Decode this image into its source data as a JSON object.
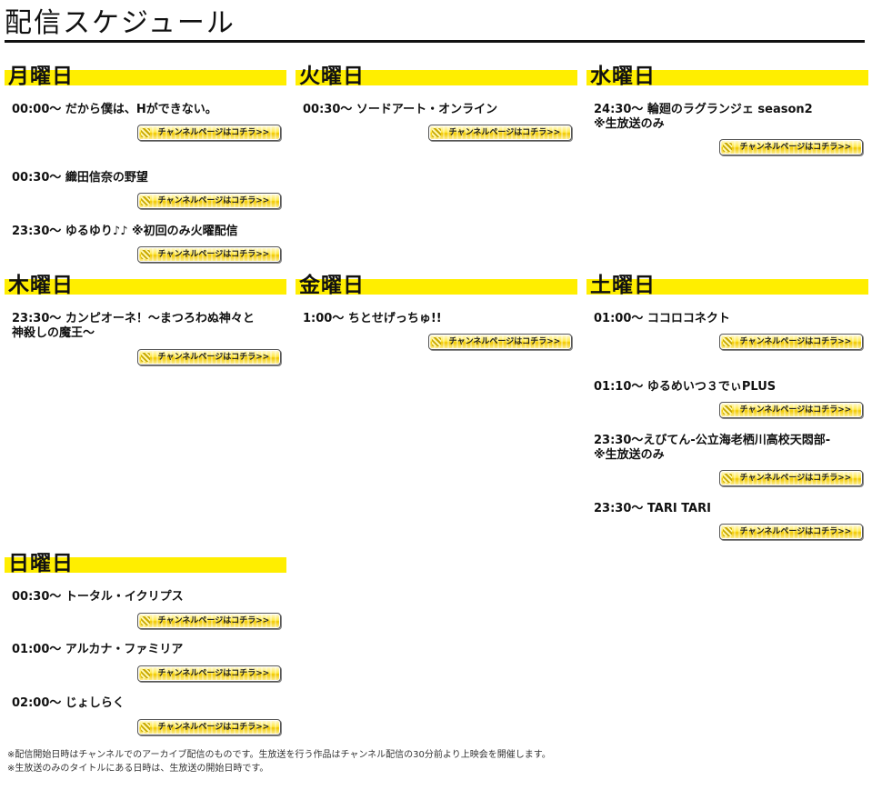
{
  "page": {
    "title": "配信スケジュール",
    "button_label": "チャンネルページはコチラ>>"
  },
  "days": [
    {
      "name": "月曜日",
      "entries": [
        {
          "text": "00:00～ だから僕は、Hができない。"
        },
        {
          "text": "00:30～ 織田信奈の野望"
        },
        {
          "text": "23:30～ ゆるゆり♪♪ ※初回のみ火曜配信"
        }
      ]
    },
    {
      "name": "火曜日",
      "entries": [
        {
          "text": "00:30～ ソードアート・オンライン"
        }
      ]
    },
    {
      "name": "水曜日",
      "entries": [
        {
          "text": "24:30～ 輪廻のラグランジェ season2\n※生放送のみ"
        }
      ]
    },
    {
      "name": "木曜日",
      "entries": [
        {
          "text": "23:30～ カンピオーネ！～まつろわぬ神々と\n神殺しの魔王～"
        }
      ]
    },
    {
      "name": "金曜日",
      "entries": [
        {
          "text": "1:00～ ちとせげっちゅ!!"
        }
      ]
    },
    {
      "name": "土曜日",
      "entries": [
        {
          "text": "01:00～ ココロコネクト"
        },
        {
          "text": "01:10～ ゆるめいつ３でぃPLUS"
        },
        {
          "text": "23:30～えびてん-公立海老栖川高校天悶部-\n※生放送のみ"
        },
        {
          "text": "23:30～ TARI TARI"
        }
      ]
    },
    {
      "name": "日曜日",
      "entries": [
        {
          "text": "00:30～ トータル・イクリプス"
        },
        {
          "text": "01:00～ アルカナ・ファミリア"
        },
        {
          "text": "02:00～ じょしらく"
        }
      ]
    }
  ],
  "footnotes": [
    "※配信開始日時はチャンネルでのアーカイブ配信のものです。生放送を行う作品はチャンネル配信の30分前より上映会を開催します。",
    "※生放送のみのタイトルにある日時は、生放送の開始日時です。"
  ],
  "colors": {
    "header_band": "#ffee00",
    "title_rule": "#111111"
  }
}
